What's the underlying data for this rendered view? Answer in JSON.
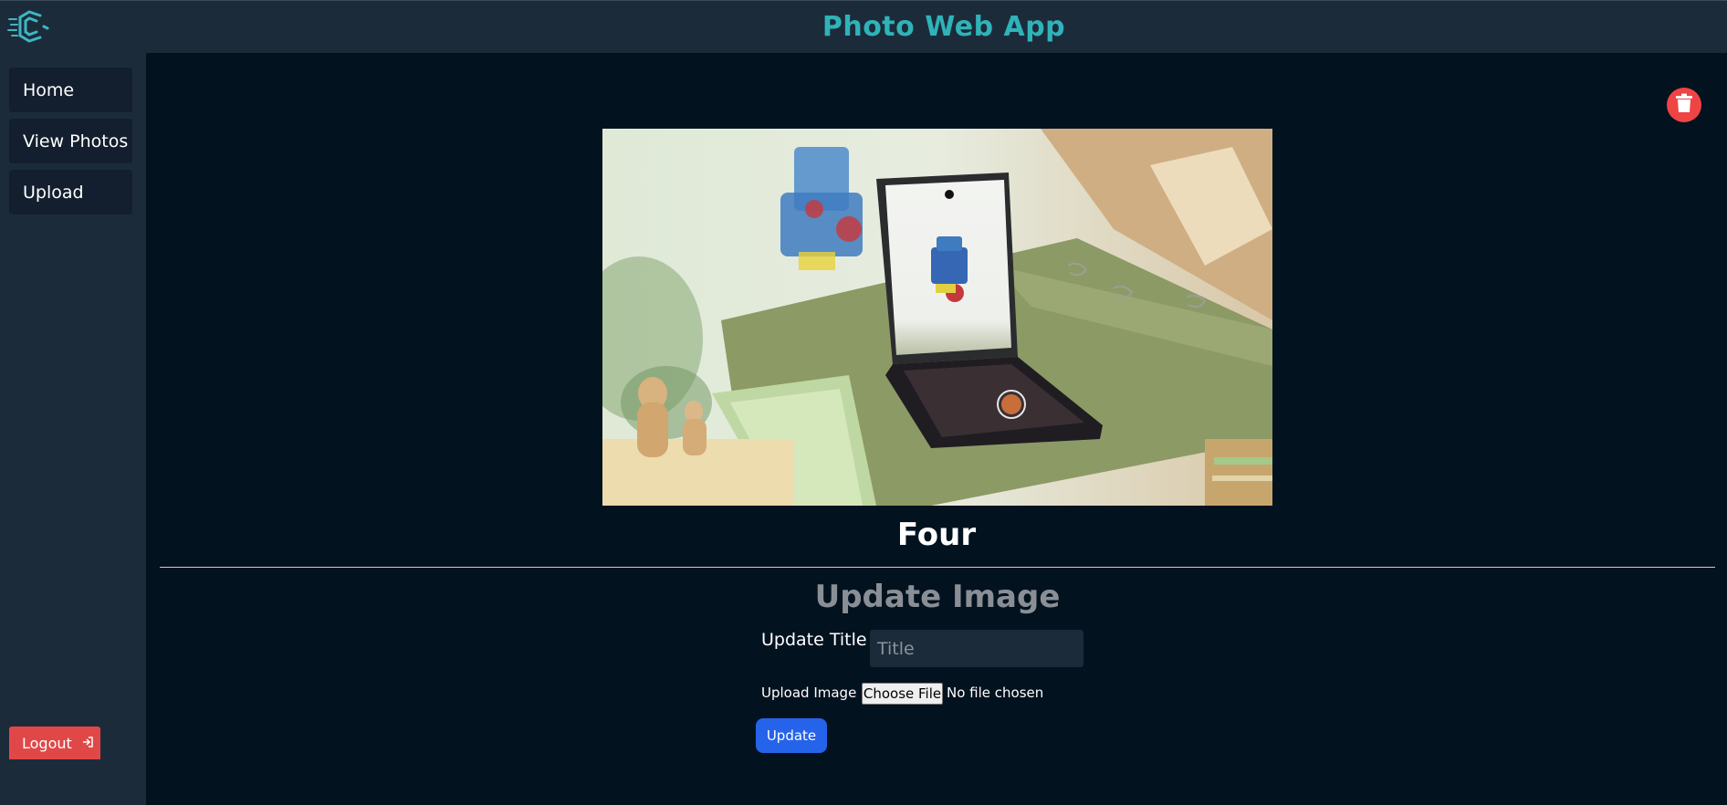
{
  "header": {
    "title": "Photo Web App",
    "logo_icon": "logo-icon",
    "accent_color": "#2fb3b8"
  },
  "sidebar": {
    "items": [
      {
        "label": "Home"
      },
      {
        "label": "View Photos"
      },
      {
        "label": "Upload"
      }
    ],
    "logout_label": "Logout",
    "logout_icon": "logout-icon",
    "logout_color": "#e04848"
  },
  "main": {
    "delete_icon": "trash-icon",
    "delete_color": "#ef4444",
    "photo_title": "Four",
    "update_section": {
      "heading": "Update Image",
      "title_label": "Update Title :",
      "title_placeholder": "Title",
      "title_value": "",
      "upload_label": "Upload Image :",
      "file_button_label": "Choose File",
      "file_status": "No file chosen",
      "submit_label": "Update",
      "submit_color": "#2563eb"
    }
  }
}
